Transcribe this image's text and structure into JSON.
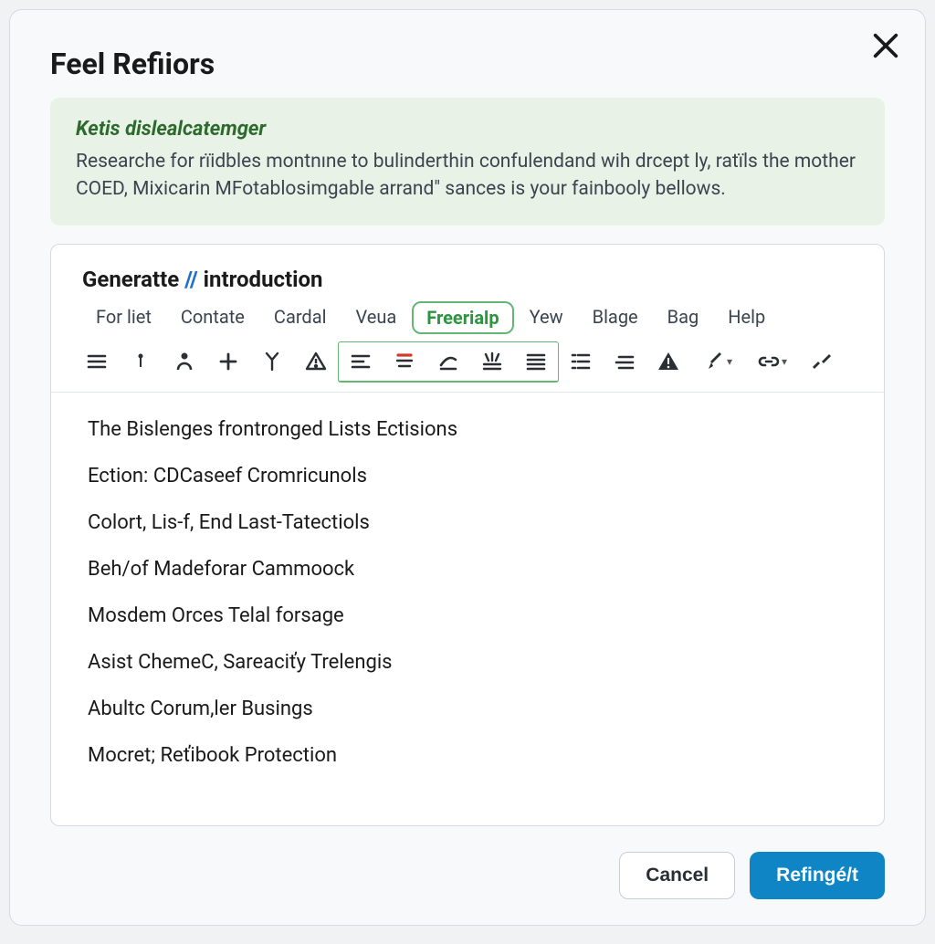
{
  "modal": {
    "title": "Feel Refiiors"
  },
  "banner": {
    "title": "Ketis dislealcatemger",
    "text": "Researche for rïidbles montnıne to bulinderthin confulendand wih drcept ly, ratïls the mother COED, Mixicarin MFotablosimgable arrand\" sances is your fainbooly bellows."
  },
  "editor": {
    "title_left": "Generatte",
    "title_right": "introduction",
    "menu": [
      {
        "label": "For liet",
        "active": false
      },
      {
        "label": "Contate",
        "active": false
      },
      {
        "label": "Cardal",
        "active": false
      },
      {
        "label": "Veua",
        "active": false
      },
      {
        "label": "Freerialp",
        "active": true
      },
      {
        "label": "Yew",
        "active": false
      },
      {
        "label": "Blage",
        "active": false
      },
      {
        "label": "Bag",
        "active": false
      },
      {
        "label": "Help",
        "active": false
      }
    ],
    "content": [
      "The Bislenges frontronged Lists Ectisions",
      "Ection: CDCaseef Cromricunols",
      "Colort, Lis-f, End Last-Tatectiols",
      "Beh/of Madeforar Cammoock",
      "Mosdem Orces Telal forsage",
      "Asist ChemeC, Sareaciťy Trelengis",
      "Abultc Corum,ler Busings",
      "Mocret; Reťibook Protection"
    ]
  },
  "footer": {
    "cancel": "Cancel",
    "confirm": "Refingé/t"
  }
}
